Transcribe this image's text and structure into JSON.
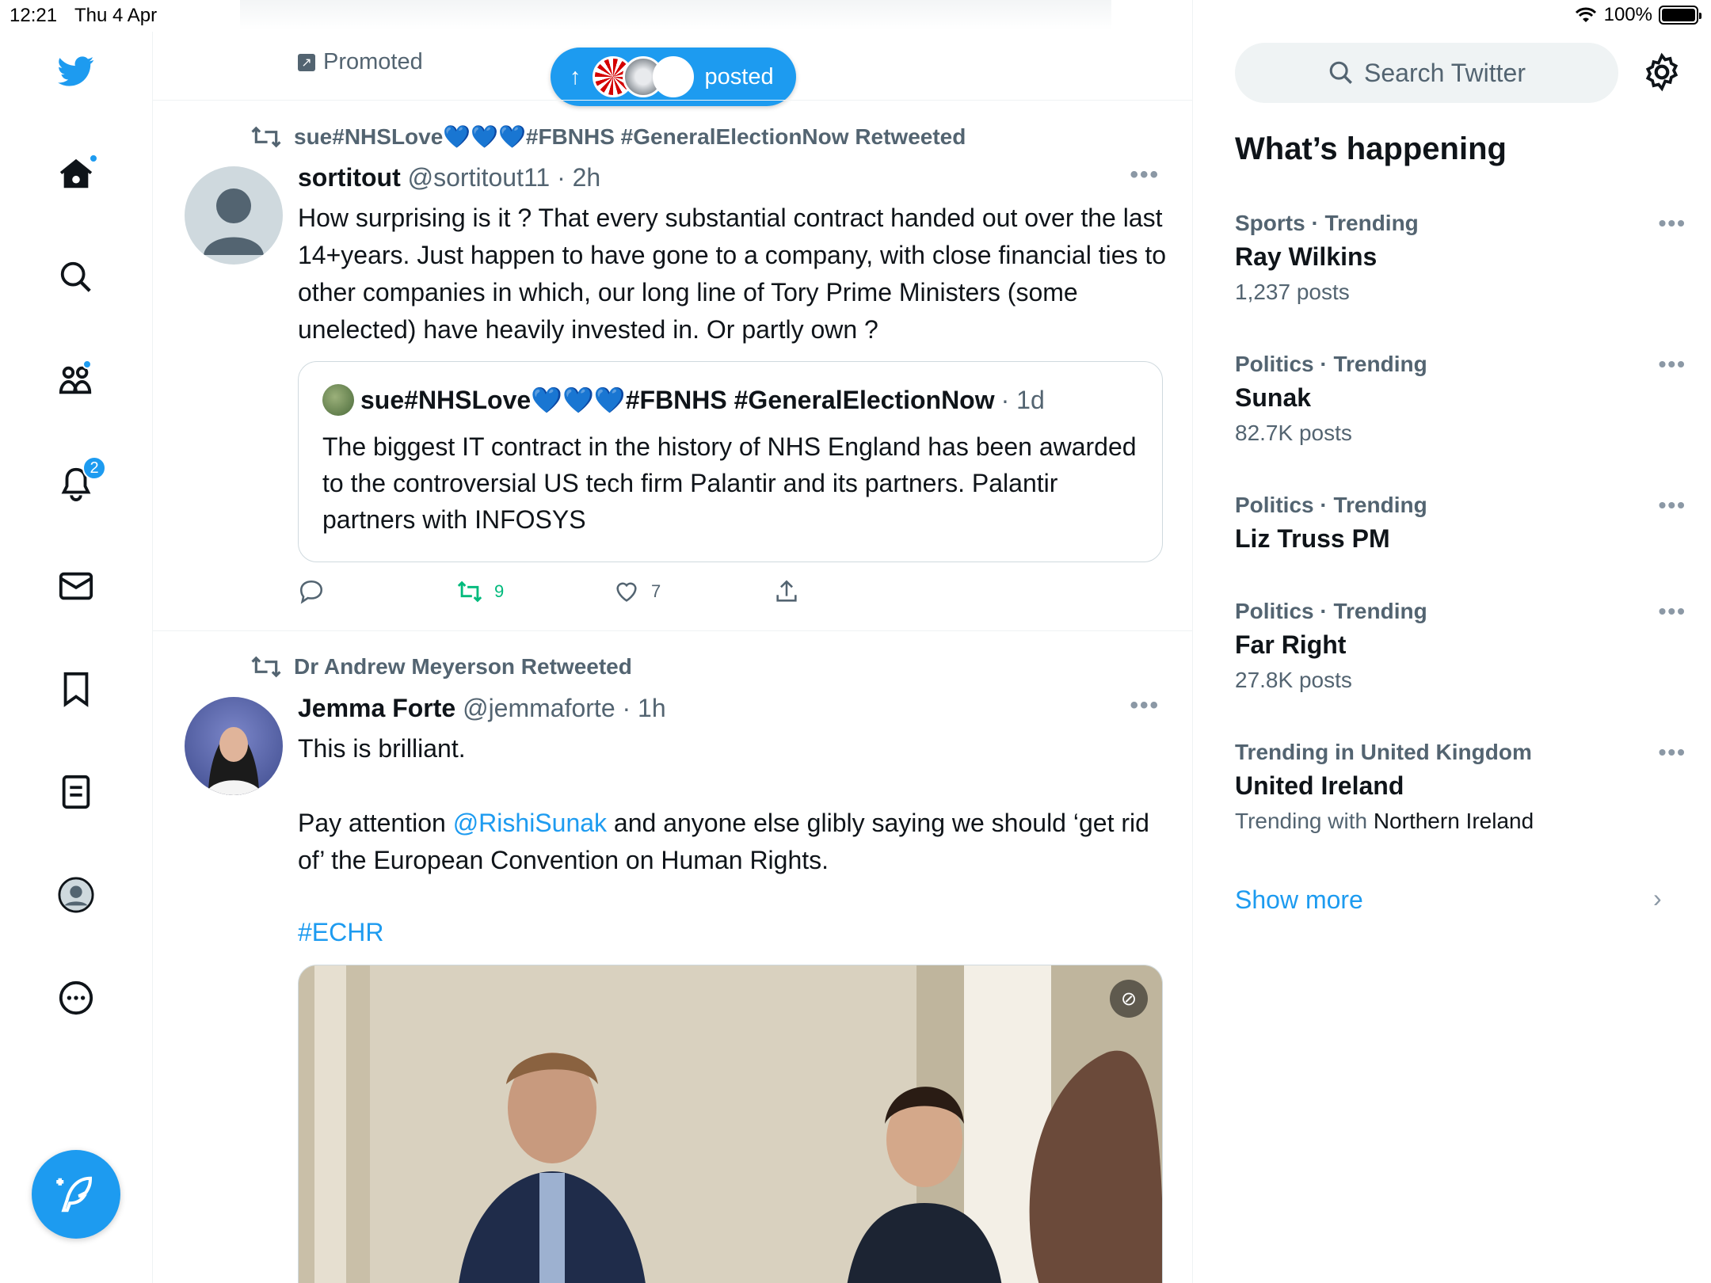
{
  "status_bar": {
    "time": "12:21",
    "date": "Thu 4 Apr",
    "battery": "100%"
  },
  "nav": {
    "notifications_badge": "2",
    "accent_color": "#1d9bf0"
  },
  "timeline": {
    "promoted_label": "Promoted",
    "new_posts_pill": "posted",
    "tweets": [
      {
        "retweeted_by": "sue#NHSLove💙💙💙#FBNHS #GeneralElectionNow Retweeted",
        "name": "sortitout",
        "handle": "@sortitout11",
        "time": "· 2h",
        "body": "How surprising is it ? That every substantial contract handed out over the last 14+years. Just happen to have gone to a company, with close financial ties to other companies in which, our long line of Tory Prime Ministers (some unelected) have heavily invested in. Or partly own ?",
        "quote": {
          "name": "sue#NHSLove💙💙💙#FBNHS #GeneralElectionNow",
          "time": "· 1d",
          "body": "The biggest IT contract in the history of NHS England has been awarded to the controversial US tech firm Palantir and its partners. Palantir partners with INFOSYS"
        },
        "retweets": "9",
        "likes": "7"
      },
      {
        "retweeted_by": "Dr Andrew Meyerson Retweeted",
        "name": "Jemma Forte",
        "handle": "@jemmaforte",
        "time": "· 1h",
        "line1": "This is brilliant.",
        "line2_pre": "Pay attention ",
        "mention": "@RishiSunak",
        "line2_post": " and anyone else glibly saying we should ‘get rid of’ the European Convention on Human Rights.",
        "hashtag": "#ECHR"
      }
    ]
  },
  "sidebar": {
    "search_placeholder": "Search Twitter",
    "title": "What’s happening",
    "trends": [
      {
        "category": "Sports · Trending",
        "name": "Ray Wilkins",
        "count": "1,237 posts"
      },
      {
        "category": "Politics · Trending",
        "name": "Sunak",
        "count": "82.7K posts"
      },
      {
        "category": "Politics · Trending",
        "name": "Liz Truss PM",
        "count": ""
      },
      {
        "category": "Politics · Trending",
        "name": "Far Right",
        "count": "27.8K posts"
      },
      {
        "category": "Trending in United Kingdom",
        "name": "United Ireland",
        "count_pre": "Trending with ",
        "count_strong": "Northern Ireland"
      }
    ],
    "show_more": "Show more"
  }
}
